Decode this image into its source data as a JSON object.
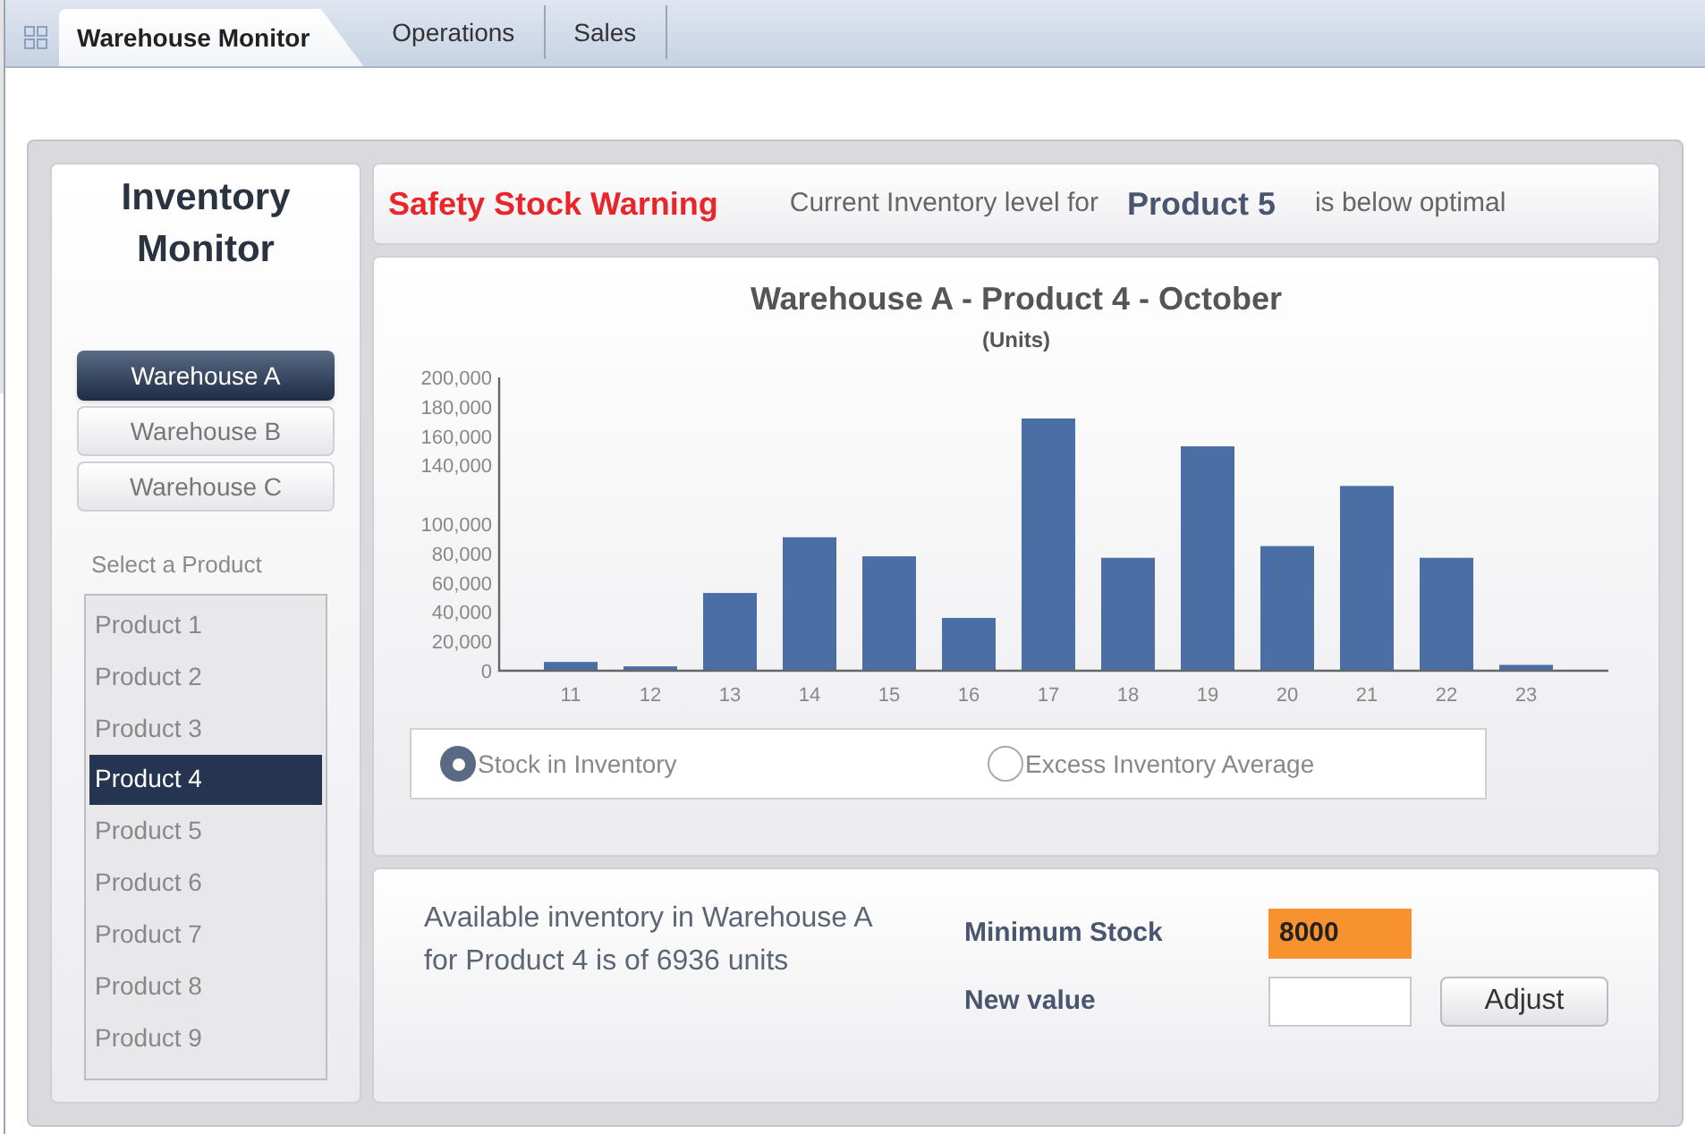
{
  "tabs": [
    {
      "label": "Warehouse Monitor",
      "selected": true
    },
    {
      "label": "Operations",
      "selected": false
    },
    {
      "label": "Sales",
      "selected": false
    }
  ],
  "sidebar": {
    "title": "Inventory Monitor",
    "warehouses": [
      {
        "label": "Warehouse A",
        "selected": true
      },
      {
        "label": "Warehouse B",
        "selected": false
      },
      {
        "label": "Warehouse C",
        "selected": false
      }
    ],
    "product_label": "Select a Product",
    "products": [
      {
        "label": "Product 1",
        "selected": false
      },
      {
        "label": "Product 2",
        "selected": false
      },
      {
        "label": "Product 3",
        "selected": false
      },
      {
        "label": "Product 4",
        "selected": true
      },
      {
        "label": "Product 5",
        "selected": false
      },
      {
        "label": "Product 6",
        "selected": false
      },
      {
        "label": "Product 7",
        "selected": false
      },
      {
        "label": "Product 8",
        "selected": false
      },
      {
        "label": "Product 9",
        "selected": false
      }
    ]
  },
  "warning": {
    "title": "Safety Stock Warning",
    "message_prefix": "Current Inventory level for",
    "product": "Product 5",
    "message_suffix": "is below optimal"
  },
  "chart": {
    "chart_data": {
      "type": "bar",
      "title": "Warehouse A - Product 4 - October",
      "ylabel": "(Units)",
      "categories": [
        "11",
        "12",
        "13",
        "14",
        "15",
        "16",
        "17",
        "18",
        "19",
        "20",
        "21",
        "22",
        "23"
      ],
      "series": [
        {
          "color": "#4a6fa5",
          "values": [
            6000,
            3000,
            53000,
            91000,
            78000,
            36000,
            172000,
            77000,
            153000,
            85000,
            126000,
            77000,
            4000
          ]
        }
      ],
      "ylim": [
        0,
        200000
      ],
      "yticks": [
        {
          "value": 0,
          "label": "0"
        },
        {
          "value": 20000,
          "label": "20,000"
        },
        {
          "value": 40000,
          "label": "40,000"
        },
        {
          "value": 60000,
          "label": "60,000"
        },
        {
          "value": 80000,
          "label": "80,000"
        },
        {
          "value": 100000,
          "label": "100,000"
        },
        {
          "value": 140000,
          "label": "140,000"
        },
        {
          "value": 160000,
          "label": "160,000"
        },
        {
          "value": 180000,
          "label": "180,000"
        },
        {
          "value": 200000,
          "label": "200,000"
        }
      ]
    },
    "options": [
      {
        "label": "Stock in Inventory",
        "selected": true
      },
      {
        "label": "Excess Inventory Average",
        "selected": false
      }
    ]
  },
  "summary": {
    "text": "Available inventory in Warehouse A for Product 4 is of 6936 units",
    "minimum_label": "Minimum Stock",
    "minimum_value": "8000",
    "new_value_label": "New value",
    "button": "Adjust"
  }
}
